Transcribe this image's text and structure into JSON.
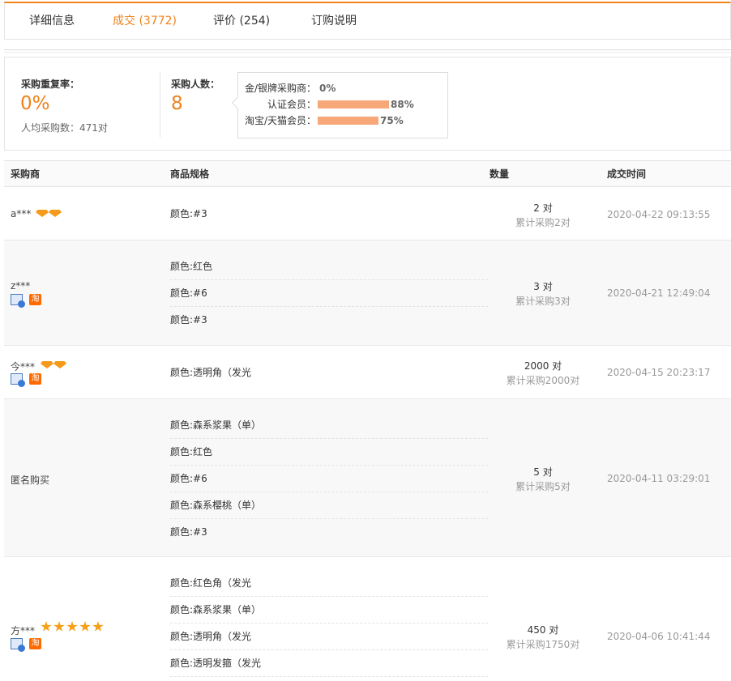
{
  "tabs": [
    {
      "label": "详细信息"
    },
    {
      "label": "成交 (3772)"
    },
    {
      "label": "评价 (254)"
    },
    {
      "label": "订购说明"
    }
  ],
  "stats": {
    "repurchase_label": "采购重复率：",
    "repurchase_value": "0%",
    "avg_label": "人均采购数：471对",
    "buyers_label": "采购人数：",
    "buyers_value": "8",
    "breakdown": [
      {
        "label": "金/银牌采购商：",
        "value": "0%",
        "fraction": 0
      },
      {
        "label": "认证会员：",
        "value": "88%",
        "fraction": 0.88
      },
      {
        "label": "淘宝/天猫会员：",
        "value": "75%",
        "fraction": 0.75
      }
    ]
  },
  "table": {
    "headers": {
      "buyer": "采购商",
      "spec": "商品规格",
      "qty": "数量",
      "time": "成交时间"
    },
    "rows": [
      {
        "buyer": "a***",
        "gems": 2,
        "stars": 0,
        "badges": false,
        "specs": [
          "颜色:#3"
        ],
        "qty": "2 对",
        "total": "累计采购2对",
        "time": "2020-04-22 09:13:55"
      },
      {
        "buyer": "z***",
        "gems": 0,
        "stars": 0,
        "badges": true,
        "specs": [
          "颜色:红色",
          "颜色:#6",
          "颜色:#3"
        ],
        "qty": "3 对",
        "total": "累计采购3对",
        "time": "2020-04-21 12:49:04"
      },
      {
        "buyer": "今***",
        "gems": 2,
        "stars": 0,
        "badges": true,
        "specs": [
          "颜色:透明角（发光"
        ],
        "qty": "2000 对",
        "total": "累计采购2000对",
        "time": "2020-04-15 20:23:17"
      },
      {
        "buyer": "匿名购买",
        "gems": 0,
        "stars": 0,
        "badges": false,
        "specs": [
          "颜色:森系浆果（单）",
          "颜色:红色",
          "颜色:#6",
          "颜色:森系樱桃（单）",
          "颜色:#3"
        ],
        "qty": "5 对",
        "total": "累计采购5对",
        "time": "2020-04-11 03:29:01"
      },
      {
        "buyer": "方***",
        "gems": 0,
        "stars": 5,
        "badges": true,
        "specs": [
          "颜色:红色角（发光",
          "颜色:森系浆果（单）",
          "颜色:透明角（发光",
          "颜色:透明发箍（发光"
        ],
        "qty": "450 对",
        "total": "累计采购1750对",
        "time": "2020-04-06 10:41:44"
      }
    ],
    "icons": {
      "gem": "diamond-icon",
      "star": "star-icon",
      "buyer_badge": "verified-buyer-icon",
      "tao_badge": "taobao-icon",
      "tao_text": "淘"
    }
  },
  "colors": {
    "accent": "#f0811b",
    "bar": "#f8a779",
    "alt_row": "#f8f8f8"
  }
}
